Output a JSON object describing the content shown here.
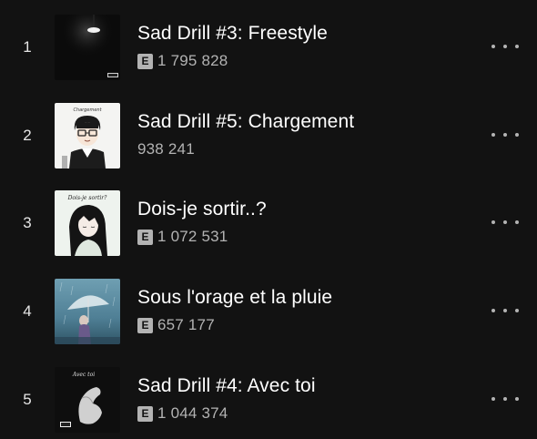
{
  "tracks": [
    {
      "rank": "1",
      "title": "Sad Drill #3: Freestyle",
      "explicit_label": "E",
      "plays": "1 795 828",
      "cover_icon": "dark-lamp-cover"
    },
    {
      "rank": "2",
      "title": "Sad Drill #5: Chargement",
      "plays": "938 241",
      "cover_icon": "cartoon-glasses-cover",
      "cover_text": "Chargement"
    },
    {
      "rank": "3",
      "title": "Dois-je sortir..?",
      "explicit_label": "E",
      "plays": "1 072 531",
      "cover_icon": "anime-girl-cover",
      "cover_text": "Dois-je sortir?"
    },
    {
      "rank": "4",
      "title": "Sous l'orage et la pluie",
      "explicit_label": "E",
      "plays": "657 177",
      "cover_icon": "umbrella-rain-cover"
    },
    {
      "rank": "5",
      "title": "Sad Drill #4: Avec toi",
      "explicit_label": "E",
      "plays": "1 044 374",
      "cover_icon": "hand-bw-cover",
      "cover_text": "Avec toi"
    }
  ],
  "colors": {
    "background": "#121212",
    "title": "#ffffff",
    "secondary": "#b3b3b3"
  }
}
